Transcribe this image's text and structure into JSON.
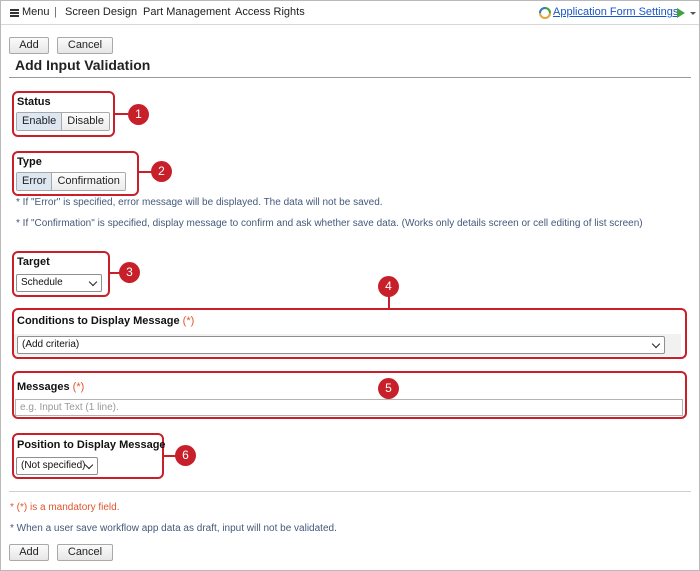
{
  "menubar": {
    "menu_label": "Menu",
    "separator": "|",
    "items": [
      "Screen Design",
      "Part Management",
      "Access Rights"
    ],
    "settings_link": "Application Form Settings"
  },
  "buttons": {
    "add": "Add",
    "cancel": "Cancel"
  },
  "page_title": "Add Input Validation",
  "status": {
    "label": "Status",
    "options": [
      "Enable",
      "Disable"
    ],
    "selected": "Enable"
  },
  "type": {
    "label": "Type",
    "options": [
      "Error",
      "Confirmation"
    ],
    "selected": "Error",
    "notes": [
      "* If \"Error\" is specified, error message will be displayed. The data will not be saved.",
      "* If \"Confirmation\" is specified, display message to confirm and ask whether save data. (Works only details screen or cell editing of list screen)"
    ]
  },
  "target": {
    "label": "Target",
    "value": "Schedule"
  },
  "conditions": {
    "label": "Conditions to Display Message",
    "required_mark": "(*)",
    "value": "(Add criteria)"
  },
  "messages": {
    "label": "Messages",
    "required_mark": "(*)",
    "placeholder": "e.g. Input Text (1 line)."
  },
  "position": {
    "label": "Position to Display Message",
    "value": "(Not specified)"
  },
  "footer_notes": {
    "mandatory": "* (*) is a mandatory field.",
    "draft": "* When a user save workflow app data as draft, input will not be validated."
  },
  "callouts": [
    "1",
    "2",
    "3",
    "4",
    "5",
    "6"
  ],
  "colors": {
    "callout": "#c8202a",
    "link": "#1a56c8",
    "required": "#e0552b",
    "note": "#44597a"
  }
}
